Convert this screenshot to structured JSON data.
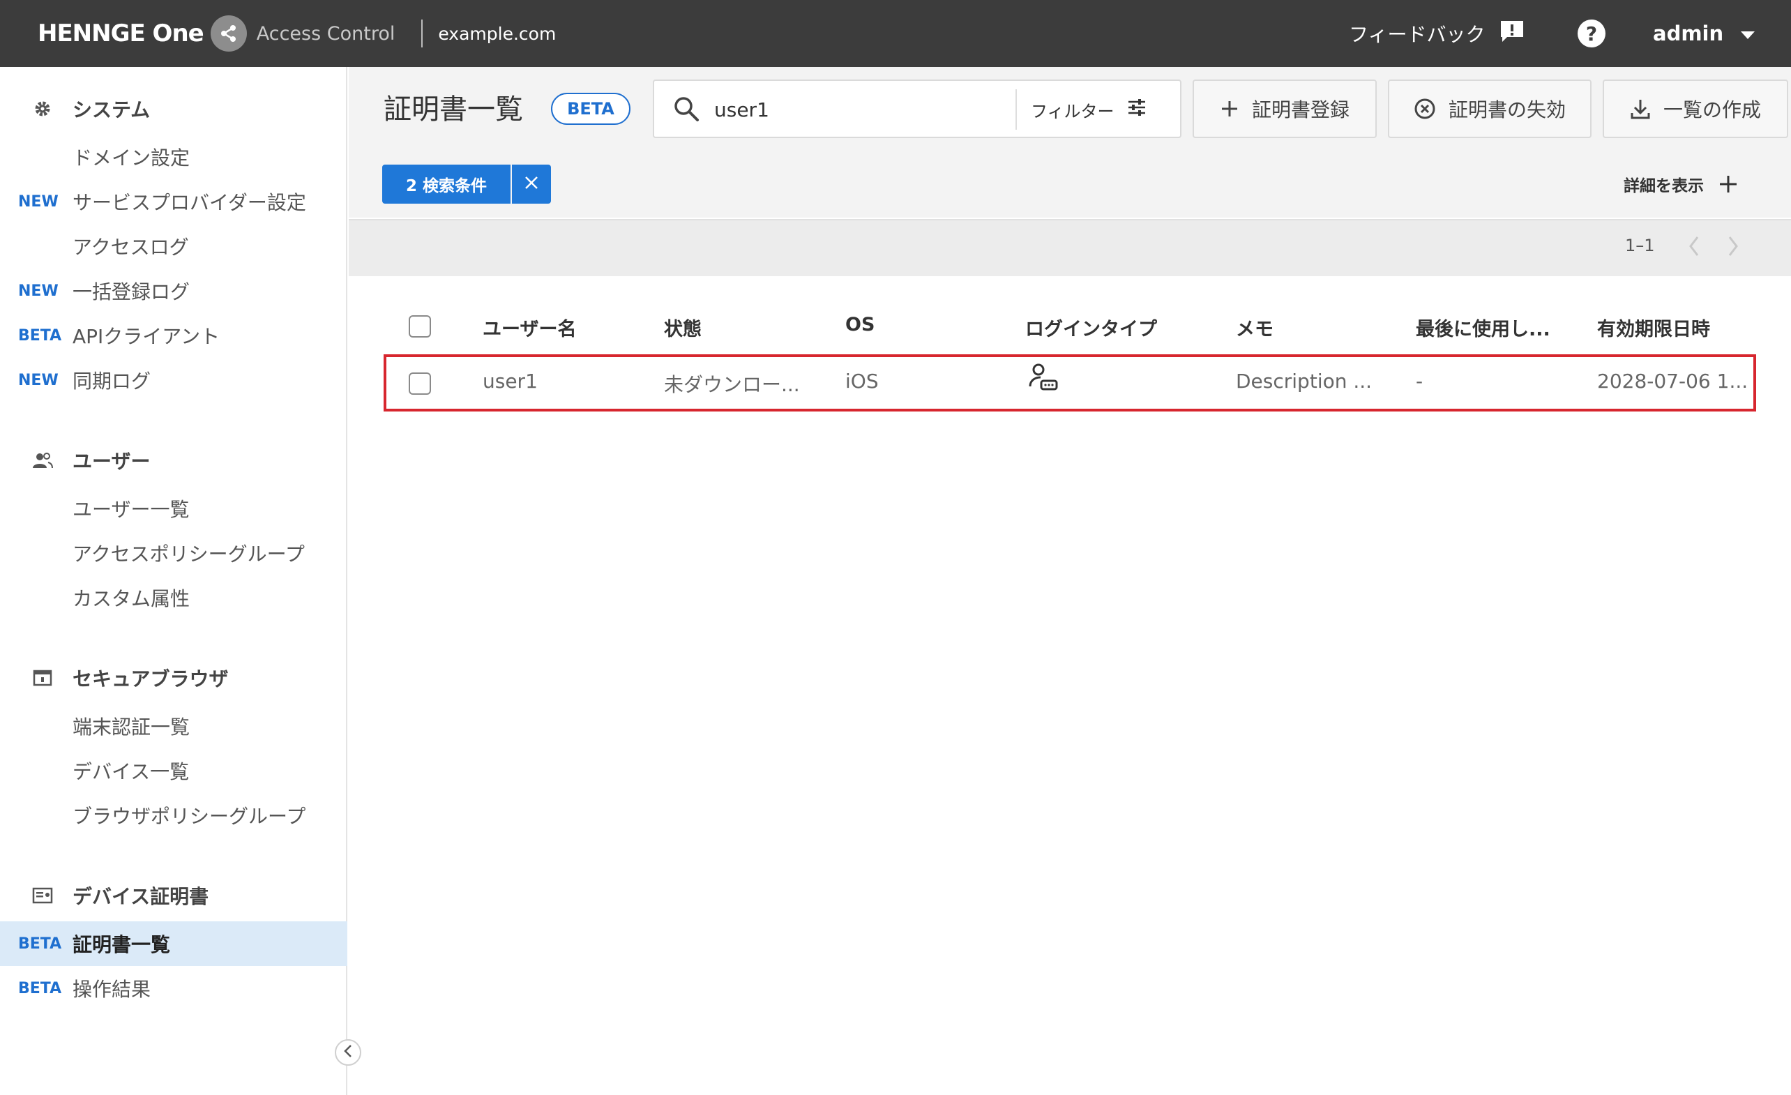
{
  "header": {
    "brand_name": "HENNGE One",
    "product_name": "Access Control",
    "domain": "example.com",
    "feedback_label": "フィードバック",
    "help_label": "?",
    "account_name": "admin"
  },
  "sidebar": {
    "sections": [
      {
        "title": "システム",
        "icon": "gear-icon",
        "items": [
          {
            "badge": "",
            "label": "ドメイン設定"
          },
          {
            "badge": "NEW",
            "label": "サービスプロバイダー設定"
          },
          {
            "badge": "",
            "label": "アクセスログ"
          },
          {
            "badge": "NEW",
            "label": "一括登録ログ"
          },
          {
            "badge": "BETA",
            "label": "APIクライアント"
          },
          {
            "badge": "NEW",
            "label": "同期ログ"
          }
        ]
      },
      {
        "title": "ユーザー",
        "icon": "users-icon",
        "items": [
          {
            "badge": "",
            "label": "ユーザー一覧"
          },
          {
            "badge": "",
            "label": "アクセスポリシーグループ"
          },
          {
            "badge": "",
            "label": "カスタム属性"
          }
        ]
      },
      {
        "title": "セキュアブラウザ",
        "icon": "browser-icon",
        "items": [
          {
            "badge": "",
            "label": "端末認証一覧"
          },
          {
            "badge": "",
            "label": "デバイス一覧"
          },
          {
            "badge": "",
            "label": "ブラウザポリシーグループ"
          }
        ]
      },
      {
        "title": "デバイス証明書",
        "icon": "certificate-icon",
        "items": [
          {
            "badge": "BETA",
            "label": "証明書一覧",
            "active": true
          },
          {
            "badge": "BETA",
            "label": "操作結果"
          }
        ]
      }
    ]
  },
  "main": {
    "title": "証明書一覧",
    "title_badge": "BETA",
    "search": {
      "value": "user1",
      "placeholder": ""
    },
    "filter_label": "フィルター",
    "buttons": {
      "register": "証明書登録",
      "revoke": "証明書の失効",
      "export": "一覧の作成"
    },
    "condition_chip": "2 検索条件",
    "show_details": "詳細を表示",
    "pager": {
      "range": "1–1"
    },
    "table": {
      "columns": [
        "ユーザー名",
        "状態",
        "OS",
        "ログインタイプ",
        "メモ",
        "最後に使用し...",
        "有効期限日時"
      ],
      "rows": [
        {
          "username": "user1",
          "status": "未ダウンロー...",
          "os": "iOS",
          "login_type_icon": "user-password-icon",
          "memo": "Description ...",
          "last_used": "-",
          "expires": "2028-07-06 1..."
        }
      ]
    }
  },
  "colors": {
    "topbar": "#3c3c3c",
    "accent": "#1f6fcf",
    "highlight": "#d7262e",
    "active_nav": "#dbeaf8"
  }
}
